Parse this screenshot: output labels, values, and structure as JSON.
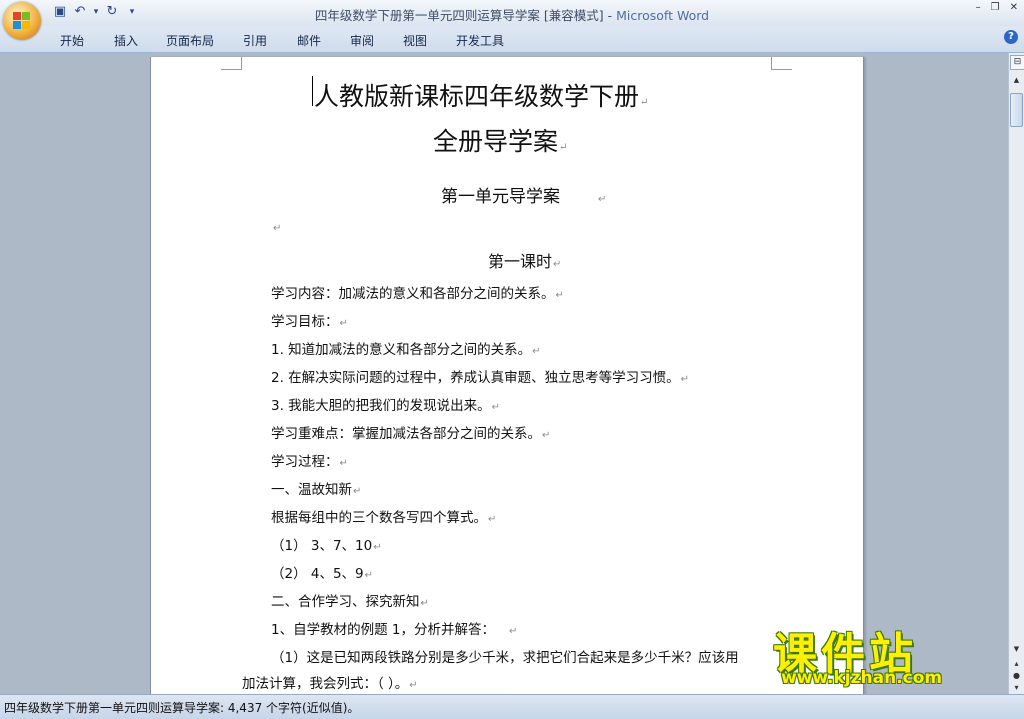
{
  "window": {
    "title_doc": "四年级数学下册第一单元四则运算导学案 [兼容模式] - ",
    "title_app": "Microsoft Word"
  },
  "qat": {
    "save_icon": "▣",
    "undo_icon": "↶",
    "undo_dropdown": "▾",
    "redo_icon": "↻",
    "customize_icon": "▾"
  },
  "window_controls": {
    "minimize": "–",
    "restore": "❐",
    "close": "✕"
  },
  "ribbon": {
    "tabs": [
      "开始",
      "插入",
      "页面布局",
      "引用",
      "邮件",
      "审阅",
      "视图",
      "开发工具"
    ],
    "help_label": "?"
  },
  "document": {
    "title1": "人教版新课标四年级数学下册",
    "title2": "全册导学案",
    "unit_title": "第一单元导学案",
    "lesson_title": "第一课时",
    "paragraph_mark": "↵",
    "lines": [
      "学习内容：加减法的意义和各部分之间的关系。",
      "学习目标：",
      "1. 知道加减法的意义和各部分之间的关系。",
      "2. 在解决实际问题的过程中，养成认真审题、独立思考等学习习惯。",
      "3. 我能大胆的把我们的发现说出来。",
      "学习重难点：掌握加减法各部分之间的关系。",
      "学习过程：",
      "一、温故知新",
      "根据每组中的三个数各写四个算式。",
      "（1）  3、7、10",
      "（2）  4、5、9",
      "二、合作学习、探究新知",
      "1、自学教材的例题 1，分析并解答：",
      "（1）这是已知两段铁路分别是多少千米，求把它们合起来是多少千米？应该用",
      "加法计算，我会列式：（                          ）。"
    ]
  },
  "scrollbar": {
    "ruler_icon": "⊟",
    "up": "▲",
    "down": "▼",
    "prev": "▴",
    "browse": "●",
    "next": "▾"
  },
  "statusbar": {
    "text": "四年级数学下册第一单元四则运算导学案: 4,437 个字符(近似值)。"
  },
  "watermark": {
    "main": "课件站",
    "url": "www.kjzhan.com"
  }
}
